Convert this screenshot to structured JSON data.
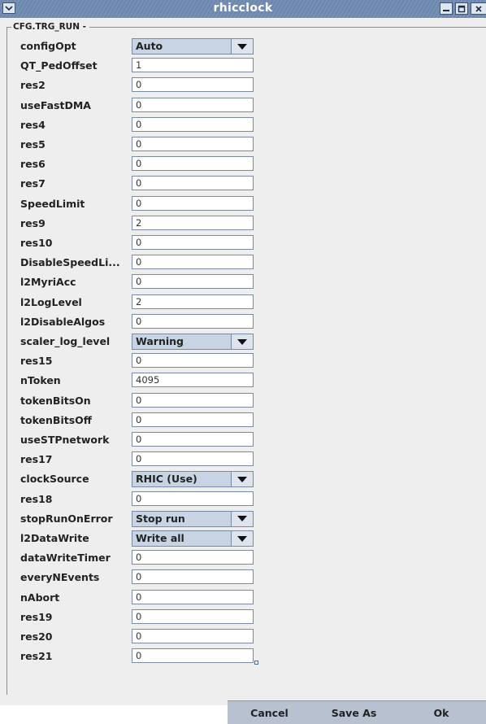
{
  "window": {
    "title": "rhicclock",
    "menu_icon": "chevron-down-icon",
    "minimize_icon": "minimize-icon",
    "maximize_icon": "maximize-icon",
    "close_icon": "close-icon"
  },
  "group": {
    "legend": "CFG.TRG_RUN -"
  },
  "fields": [
    {
      "label": "configOpt",
      "kind": "combo",
      "value": "Auto"
    },
    {
      "label": "QT_PedOffset",
      "kind": "text",
      "value": "1"
    },
    {
      "label": "res2",
      "kind": "text",
      "value": "0"
    },
    {
      "label": "useFastDMA",
      "kind": "text",
      "value": "0"
    },
    {
      "label": "res4",
      "kind": "text",
      "value": "0"
    },
    {
      "label": "res5",
      "kind": "text",
      "value": "0"
    },
    {
      "label": "res6",
      "kind": "text",
      "value": "0"
    },
    {
      "label": "res7",
      "kind": "text",
      "value": "0"
    },
    {
      "label": "SpeedLimit",
      "kind": "text",
      "value": "0"
    },
    {
      "label": "res9",
      "kind": "text",
      "value": "2"
    },
    {
      "label": "res10",
      "kind": "text",
      "value": "0"
    },
    {
      "label": "DisableSpeedLi...",
      "kind": "text",
      "value": "0"
    },
    {
      "label": "l2MyriAcc",
      "kind": "text",
      "value": "0"
    },
    {
      "label": "l2LogLevel",
      "kind": "text",
      "value": "2"
    },
    {
      "label": "l2DisableAlgos",
      "kind": "text",
      "value": "0"
    },
    {
      "label": "scaler_log_level",
      "kind": "combo",
      "value": "Warning"
    },
    {
      "label": "res15",
      "kind": "text",
      "value": "0"
    },
    {
      "label": "nToken",
      "kind": "text",
      "value": "4095"
    },
    {
      "label": "tokenBitsOn",
      "kind": "text",
      "value": "0"
    },
    {
      "label": "tokenBitsOff",
      "kind": "text",
      "value": "0"
    },
    {
      "label": "useSTPnetwork",
      "kind": "text",
      "value": "0"
    },
    {
      "label": "res17",
      "kind": "text",
      "value": "0"
    },
    {
      "label": "clockSource",
      "kind": "combo",
      "value": "RHIC (Use)"
    },
    {
      "label": "res18",
      "kind": "text",
      "value": "0"
    },
    {
      "label": "stopRunOnError",
      "kind": "combo",
      "value": "Stop run"
    },
    {
      "label": "l2DataWrite",
      "kind": "combo",
      "value": "Write all"
    },
    {
      "label": "dataWriteTimer",
      "kind": "text",
      "value": "0"
    },
    {
      "label": "everyNEvents",
      "kind": "text",
      "value": "0"
    },
    {
      "label": "nAbort",
      "kind": "text",
      "value": "0"
    },
    {
      "label": "res19",
      "kind": "text",
      "value": "0"
    },
    {
      "label": "res20",
      "kind": "text",
      "value": "0"
    },
    {
      "label": "res21",
      "kind": "text",
      "value": "0"
    }
  ],
  "buttons": {
    "cancel": "Cancel",
    "save_as": "Save As",
    "ok": "Ok"
  },
  "colors": {
    "titlebar": "#6d87ae",
    "combo_bg": "#c8d3e3",
    "button_bar": "#b7c1cf",
    "panel_bg": "#eeeeee"
  }
}
